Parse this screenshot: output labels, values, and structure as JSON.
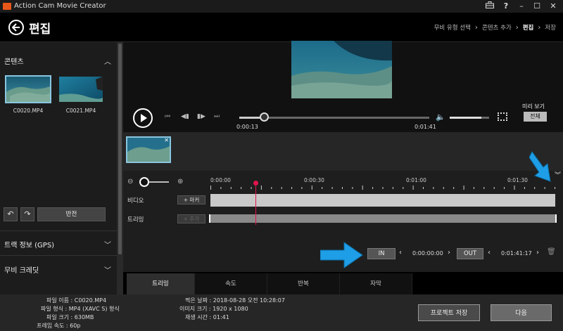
{
  "window": {
    "title": "Action Cam Movie Creator",
    "controls": [
      "toolbox-icon",
      "help-icon",
      "minimize-icon",
      "maximize-icon",
      "close-icon"
    ]
  },
  "header": {
    "title": "편집",
    "breadcrumb": [
      {
        "label": "무비 유형 선택",
        "current": false
      },
      {
        "label": "콘텐츠 추가",
        "current": false
      },
      {
        "label": "편집",
        "current": true
      },
      {
        "label": "저장",
        "current": false
      }
    ]
  },
  "sidebar": {
    "contents_label": "콘텐츠",
    "clips": [
      {
        "name": "C0020.MP4",
        "selected": true
      },
      {
        "name": "C0021.MP4",
        "selected": false
      }
    ],
    "rotate_left_icon": "rotate-left-icon",
    "rotate_right_icon": "rotate-right-icon",
    "flip_label": "반전",
    "gps_label": "트랙 정보 (GPS)",
    "credit_label": "무비 크레딧"
  },
  "player": {
    "current_time": "0:00:13",
    "duration": "0:01:41",
    "progress_fraction": 0.13,
    "volume_fraction": 0.8,
    "preview_label": "미리 보기",
    "preview_all_label": "전체"
  },
  "timeline": {
    "ruler_labels": [
      "0:00:00",
      "0:00:30",
      "0:01:00",
      "0:01:30"
    ],
    "video_label": "비디오",
    "trim_label": "트리밍",
    "marker_label": "마커",
    "add_label": "추가",
    "playhead_time": "0:00:13"
  },
  "inout": {
    "in_label": "IN",
    "in_time": "0:00:00:00",
    "out_label": "OUT",
    "out_time": "0:01:41:17"
  },
  "tabs": [
    {
      "label": "트리밍",
      "active": true
    },
    {
      "label": "속도",
      "active": false
    },
    {
      "label": "반복",
      "active": false
    },
    {
      "label": "자막",
      "active": false
    }
  ],
  "info": {
    "left": [
      "파일 이름 : C0020.MP4",
      "파일 형식 : MP4 (XAVC S) 형식",
      "파일 크기 : 630MB",
      "프레임 속도 : 60p"
    ],
    "right": [
      "찍은 날짜 : 2018-08-28 오전 10:28:07",
      "이미지 크기 : 1920 x 1080",
      "재생 시간 : 01:41"
    ]
  },
  "footer": {
    "save_project_label": "프로젝트 저장",
    "next_label": "다음"
  },
  "colors": {
    "accent_orange": "#e8571a",
    "playhead_red": "#e0144c",
    "selection_blue": "#8ac6e0",
    "annotation_arrow_blue": "#1e9ee6"
  }
}
